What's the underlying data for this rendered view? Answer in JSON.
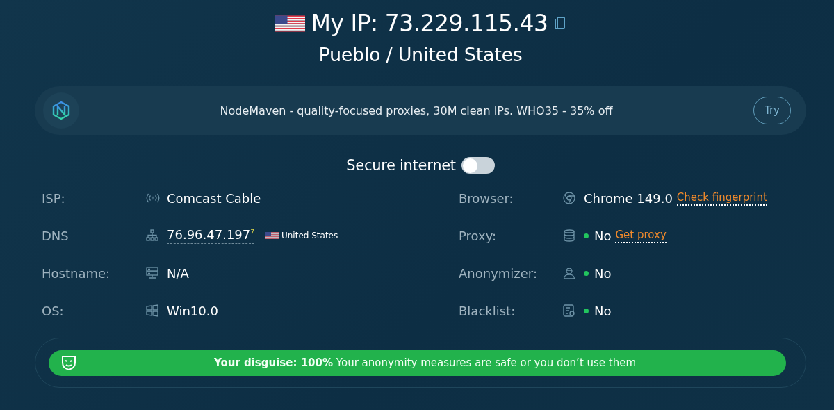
{
  "header": {
    "ip": "My IP: 73.229.115.43",
    "location": "Pueblo / United States"
  },
  "promo": {
    "text": "NodeMaven - quality-focused proxies, 30M clean IPs. WHO35 - 35% off",
    "button": "Try"
  },
  "secure": {
    "label": "Secure internet",
    "on": false
  },
  "left_rows": [
    {
      "kind": "isp",
      "label": "ISP:",
      "value": "Comcast Cable"
    },
    {
      "kind": "dns",
      "label": "DNS",
      "value": "76.96.47.197",
      "superscript": "7",
      "country": "United States"
    },
    {
      "kind": "host",
      "label": "Hostname:",
      "value": "N/A"
    },
    {
      "kind": "os",
      "label": "OS:",
      "value": "Win10.0"
    }
  ],
  "right_rows": [
    {
      "kind": "browser",
      "label": "Browser:",
      "value": "Chrome 149.0",
      "link": "Check fingerprint"
    },
    {
      "kind": "proxy",
      "label": "Proxy:",
      "value": "No",
      "color": "#22c55e",
      "link": "Get proxy"
    },
    {
      "kind": "anon",
      "label": "Anonymizer:",
      "value": "No",
      "color": "#22c55e"
    },
    {
      "kind": "blacklist",
      "label": "Blacklist:",
      "value": "No",
      "color": "#22c55e"
    }
  ],
  "verdict": {
    "text": "**Your disguise: 100%** Your anonymity measures are safe or you don’t use them"
  }
}
